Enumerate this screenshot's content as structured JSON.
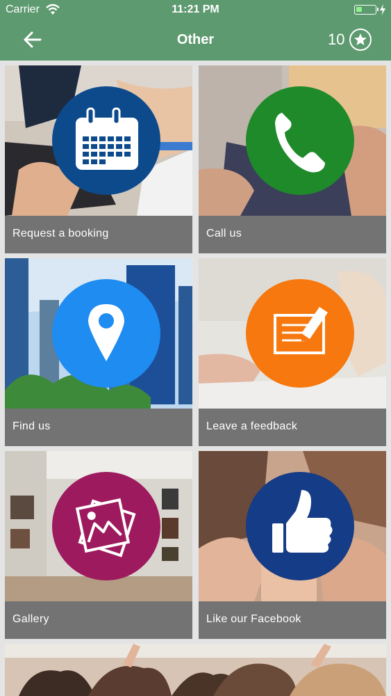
{
  "status_bar": {
    "carrier": "Carrier",
    "time": "11:21 PM"
  },
  "nav": {
    "title": "Other",
    "points": "10"
  },
  "colors": {
    "header": "#5e9a70",
    "label_bar": "#737373",
    "booking": "#0d4a8c",
    "call": "#1e8a2a",
    "find": "#1e8cf0",
    "feedback": "#f6780e",
    "gallery": "#9e1a5e",
    "facebook": "#153c86"
  },
  "tiles": [
    {
      "label": "Request a booking",
      "icon": "calendar-icon"
    },
    {
      "label": "Call us",
      "icon": "phone-icon"
    },
    {
      "label": "Find us",
      "icon": "map-pin-icon"
    },
    {
      "label": "Leave a feedback",
      "icon": "feedback-pencil-icon"
    },
    {
      "label": "Gallery",
      "icon": "gallery-photos-icon"
    },
    {
      "label": "Like our Facebook",
      "icon": "thumbs-up-icon"
    }
  ]
}
